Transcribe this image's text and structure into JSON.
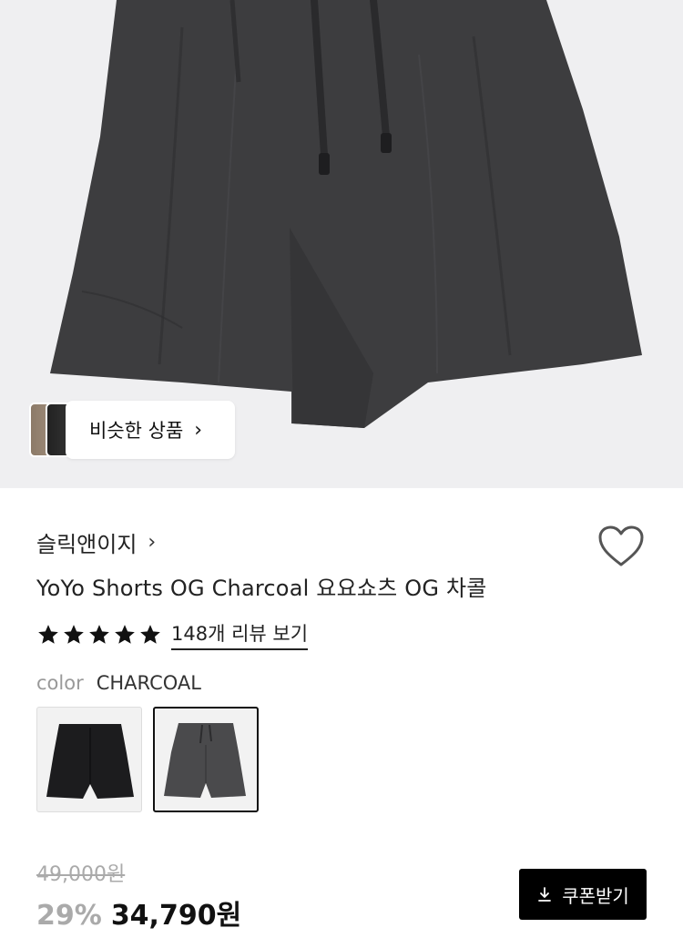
{
  "hero": {
    "similar_label": "비슷한 상품",
    "chevron": "›"
  },
  "product": {
    "brand": "슬릭앤이지",
    "brand_chevron": "›",
    "title": "YoYo Shorts OG Charcoal 요요쇼츠 OG 차콜",
    "rating_stars": 5,
    "review_link": "148개 리뷰 보기",
    "color_label": "color",
    "color_value": "CHARCOAL",
    "swatches": [
      {
        "name": "black",
        "selected": false
      },
      {
        "name": "charcoal",
        "selected": true
      }
    ],
    "original_price": "49,000원",
    "discount": "29%",
    "sale_price": "34,790원",
    "coupon_label": "쿠폰받기"
  },
  "icons": {
    "heart": "heart-icon",
    "download": "download-icon",
    "star": "star-icon"
  }
}
